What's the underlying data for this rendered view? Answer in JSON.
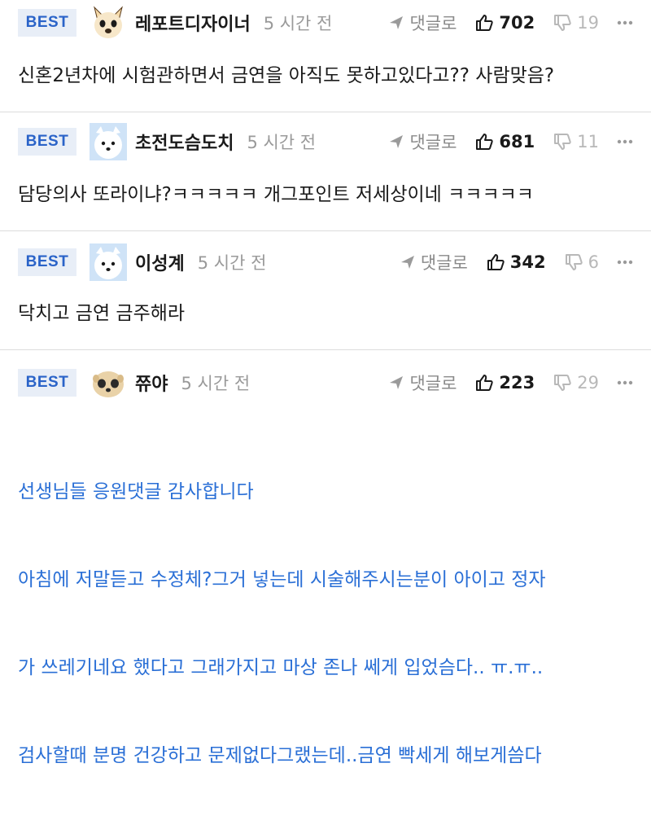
{
  "badge_label": "BEST",
  "reply_label": "댓글로",
  "comments": [
    {
      "author": "레포트디자이너",
      "time": "5 시간 전",
      "likes": "702",
      "dislikes": "19",
      "avatar": "cat-face-icon",
      "text": "신혼2년차에 시험관하면서 금연을 아직도 못하고있다고?? 사람맞음?"
    },
    {
      "author": "초전도슴도치",
      "time": "5 시간 전",
      "likes": "681",
      "dislikes": "11",
      "avatar": "white-dog-icon",
      "text": "담당의사 또라이냐?ㅋㅋㅋㅋㅋ 개그포인트 저세상이네 ㅋㅋㅋㅋㅋ"
    },
    {
      "author": "이성계",
      "time": "5 시간 전",
      "likes": "342",
      "dislikes": "6",
      "avatar": "white-dog-icon",
      "text": "닥치고 금연 금주해라"
    },
    {
      "author": "쮸야",
      "time": "5 시간 전",
      "likes": "223",
      "dislikes": "29",
      "avatar": "meerkat-face-icon",
      "lines": [
        "선생님들 응원댓글 감사합니다",
        "아침에 저말듣고 수정체?그거 넣는데 시술해주시는분이 아이고 정자",
        "가 쓰레기네요 했다고 그래가지고 마상 존나 쎄게 입었슴다.. ㅠ.ㅠ..",
        "검사할때 분명 건강하고 문제없다그랬는데..금연 빡세게 해보게씀다"
      ]
    }
  ],
  "colors": {
    "badge_bg": "#e8eef7",
    "badge_text": "#2a63c8",
    "author_reply_text": "#2a6fd6",
    "muted": "#9a9a9a",
    "divider": "#dcdcdc"
  }
}
